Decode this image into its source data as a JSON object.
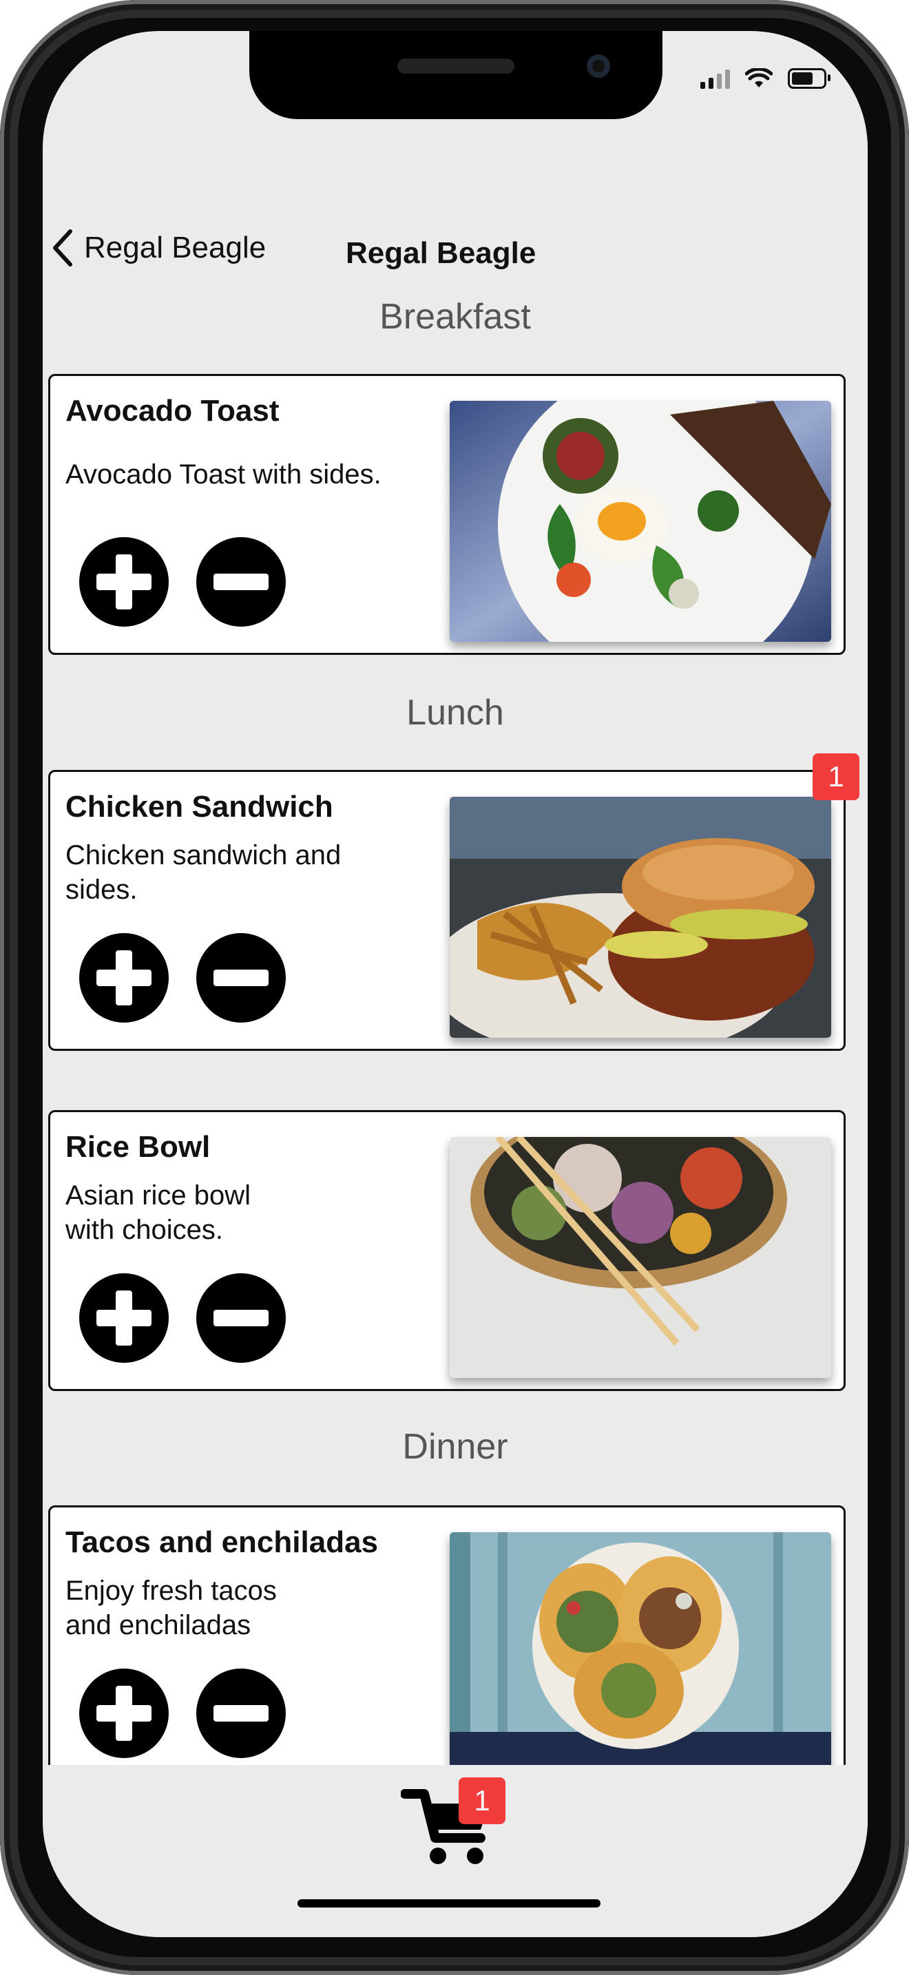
{
  "nav": {
    "back_label": "Regal Beagle",
    "title": "Regal Beagle"
  },
  "sections": {
    "breakfast": "Breakfast",
    "lunch": "Lunch",
    "dinner": "Dinner"
  },
  "items": [
    {
      "title": "Avocado Toast",
      "desc": "Avocado Toast with sides."
    },
    {
      "title": "Chicken Sandwich",
      "desc": "Chicken sandwich and sides.",
      "badge": "1"
    },
    {
      "title": "Rice Bowl",
      "desc": "Asian rice bowl with choices."
    },
    {
      "title": "Tacos and enchiladas",
      "desc": "Enjoy fresh tacos and enchiladas"
    }
  ],
  "cart": {
    "badge": "1"
  },
  "colors": {
    "accent_badge": "#f23b3b",
    "background": "#ebebeb"
  }
}
